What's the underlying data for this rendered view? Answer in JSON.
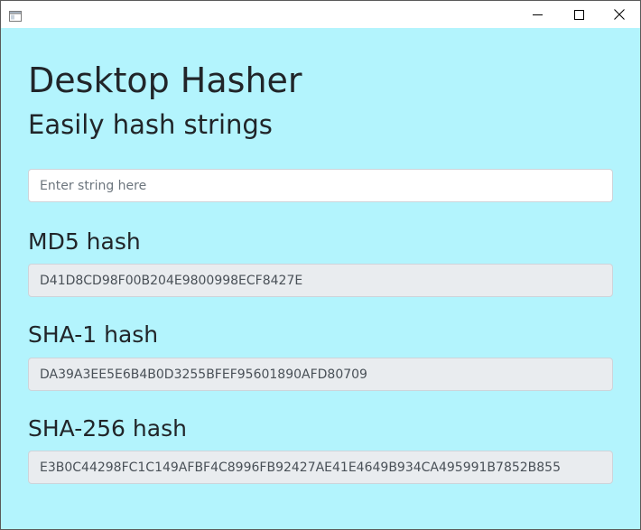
{
  "window": {
    "icon": "window-app-icon",
    "controls": [
      "minimize-icon",
      "maximize-icon",
      "close-icon"
    ]
  },
  "header": {
    "title": "Desktop Hasher",
    "subtitle": "Easily hash strings"
  },
  "input": {
    "placeholder": "Enter string here",
    "value": ""
  },
  "hashes": {
    "md5": {
      "label": "MD5 hash",
      "value": "D41D8CD98F00B204E9800998ECF8427E"
    },
    "sha1": {
      "label": "SHA-1 hash",
      "value": "DA39A3EE5E6B4B0D3255BFEF95601890AFD80709"
    },
    "sha256": {
      "label": "SHA-256 hash",
      "value": "E3B0C44298FC1C149AFBF4C8996FB92427AE41E4649B934CA495991B7852B855"
    }
  },
  "colors": {
    "background": "#b3f4fd",
    "text": "#212529",
    "readonly_field": "#e9ecef"
  }
}
